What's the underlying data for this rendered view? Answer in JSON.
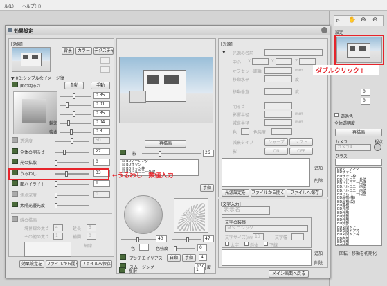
{
  "menubar": {
    "item1": "ル(L)",
    "item2": "ヘルプ(H)"
  },
  "dialog": {
    "title": "効果設定",
    "left": {
      "section": "[効果]",
      "tabs": [
        "背景",
        "カラー",
        "テクスチャ"
      ],
      "preset_dropdown": "0D:シンプルなイメージ復",
      "brightness_row": {
        "label": "面の明るさ",
        "auto": "自動",
        "manual": "手動"
      },
      "values": [
        "0.35",
        "0.01",
        "0.35",
        "0.04",
        "0.3"
      ],
      "small_labels": [
        "輪郭",
        "強さ"
      ],
      "rows": [
        {
          "label": "透過度",
          "value": "50",
          "disabled": true
        },
        {
          "label": "全体の明るさ",
          "value": "27",
          "disabled": false
        },
        {
          "label": "光の拡散",
          "value": "0",
          "disabled": false
        },
        {
          "label": "うるわし",
          "value": "33",
          "disabled": false
        },
        {
          "label": "面ハイライト",
          "value": "1",
          "disabled": false
        },
        {
          "label": "焦点深度",
          "value": "0",
          "disabled": true
        },
        {
          "label": "太陽光優先度",
          "value": "",
          "disabled": false
        }
      ],
      "edge_section": {
        "label": "線の描画",
        "sub1": "境界線の太さ",
        "sub1_value": "4",
        "sub1b": "延長",
        "sub1b_value": "5",
        "sub2": "その他の太さ",
        "sub2_value": "1",
        "sub2b": "補間",
        "sub2b_value": "0",
        "sub3": "細線"
      },
      "footer": [
        "効果設定を",
        "ファイルから開く",
        "ファイルへ保存"
      ]
    },
    "middle": {
      "redraw": "再描画",
      "shadow_label": "影",
      "shadow_value": "26",
      "list_items": [
        "BDケーシング",
        "BDサッシ",
        "BDサッシ枠",
        "BDバルコニー外壁"
      ],
      "list_manual": "手動",
      "value_a": "40",
      "value_b": "47",
      "color_label": "色",
      "colorful_label": "色強度",
      "colorful_value": "0",
      "antialias": {
        "label": "アンチエイリアス",
        "auto": "自動",
        "manual": "手動",
        "value": "4"
      },
      "smoothing": {
        "label": "スムージング",
        "value": "130",
        "unit": "度"
      },
      "reflection": {
        "label": "反射",
        "value": "1"
      }
    },
    "right": {
      "section": "[光源]",
      "light_name": "光源の名前",
      "center": "中心",
      "x": "X",
      "y": "Y",
      "z": "Z",
      "offset": "オフセット距離",
      "h_angle": "移動水平",
      "v_angle": "移動垂直",
      "brightness": "明るさ",
      "shadow_range": "影響半径",
      "decay": "減衰半径",
      "color": "色",
      "color_val": "色強度",
      "attenuation": "減衰タイプ",
      "sharp": "シャープ",
      "soft": "ソフト",
      "shadow": "影",
      "on": "ON",
      "off": "OFF",
      "unit_mm": "mm",
      "unit_deg": "度",
      "add": "追加",
      "delete": "削除",
      "footer": [
        "光源設定を",
        "ファイルから開く",
        "ファイルへ保存"
      ],
      "text_section": "[文字入力]",
      "text_placeholder": "表示名",
      "font_box": "文字の装飾",
      "font_name": "ＭＳ ゴシック",
      "font_size": "文字サイズ(mm)",
      "font_size_value": "10",
      "char_width": "文字幅",
      "bold": "太字",
      "italic": "斜体",
      "underline": "下線",
      "add2": "追加",
      "delete2": "削除",
      "main_screen": "メイン画面へ戻る"
    }
  },
  "right_panel": {
    "tools_title": "設定",
    "redraw": "再描画",
    "layer_label": "カメラ",
    "layer_value": "カメラ4",
    "view_label": "視点",
    "class_label": "クラス",
    "transparency": "透過色",
    "all_transparency": "全体透明度",
    "reset": "回転・移動を初期化",
    "value_0": "0",
    "class_items": [
      "BDケーシング",
      "BDサッシ",
      "BDサッシ枠",
      "BDバルコニー外壁",
      "BDバルコニー内壁",
      "BDバルコニー内壁",
      "BDバルコニー内壁",
      "BDバルコニー内壁",
      "BD屋根(棟)",
      "BD屋根(段)",
      "BD屋根",
      "BD外部",
      "BD外部",
      "BD外部",
      "BD外部",
      "BD外部",
      "BD玄関ドア",
      "BD玄関ドア枠",
      "BD玄関ドア枠",
      "BD内部",
      "BD外部",
      "BD外部",
      "BD外部"
    ]
  },
  "annotations": {
    "double_click": "ダブルクリック↑",
    "urowashi": "←うるわし　数値入力"
  }
}
